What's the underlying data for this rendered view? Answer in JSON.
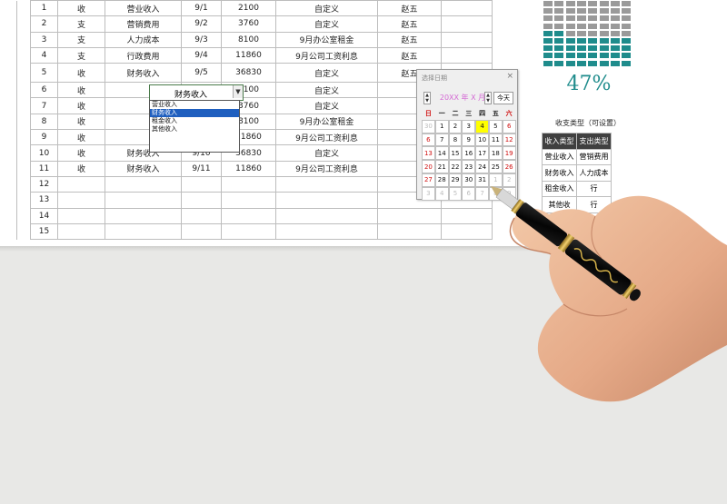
{
  "ledger": {
    "rows": [
      {
        "no": "1",
        "type": "收",
        "category": "营业收入",
        "date": "9/1",
        "amount": "2100",
        "note": "自定义",
        "person": "赵五"
      },
      {
        "no": "2",
        "type": "支",
        "category": "营销费用",
        "date": "9/2",
        "amount": "3760",
        "note": "自定义",
        "person": "赵五"
      },
      {
        "no": "3",
        "type": "支",
        "category": "人力成本",
        "date": "9/3",
        "amount": "8100",
        "note": "9月办公室租金",
        "person": "赵五"
      },
      {
        "no": "4",
        "type": "支",
        "category": "行政费用",
        "date": "9/4",
        "amount": "11860",
        "note": "9月公司工资利息",
        "person": "赵五"
      },
      {
        "no": "5",
        "type": "收",
        "category": "财务收入",
        "date": "9/5",
        "amount": "36830",
        "note": "自定义",
        "person": "赵五"
      },
      {
        "no": "6",
        "type": "收",
        "category": "",
        "date": "9/6",
        "amount": "2100",
        "note": "自定义",
        "person": ""
      },
      {
        "no": "7",
        "type": "收",
        "category": "",
        "date": "9/7",
        "amount": "3760",
        "note": "自定义",
        "person": ""
      },
      {
        "no": "8",
        "type": "收",
        "category": "",
        "date": "9/8",
        "amount": "8100",
        "note": "9月办公室租金",
        "person": ""
      },
      {
        "no": "9",
        "type": "收",
        "category": "",
        "date": "9/9",
        "amount": "11860",
        "note": "9月公司工资利息",
        "person": ""
      },
      {
        "no": "10",
        "type": "收",
        "category": "财务收入",
        "date": "9/10",
        "amount": "36830",
        "note": "自定义",
        "person": ""
      },
      {
        "no": "11",
        "type": "收",
        "category": "财务收入",
        "date": "9/11",
        "amount": "11860",
        "note": "9月公司工资利息",
        "person": ""
      },
      {
        "no": "12",
        "type": "",
        "category": "",
        "date": "",
        "amount": "",
        "note": "",
        "person": ""
      },
      {
        "no": "13",
        "type": "",
        "category": "",
        "date": "",
        "amount": "",
        "note": "",
        "person": ""
      },
      {
        "no": "14",
        "type": "",
        "category": "",
        "date": "",
        "amount": "",
        "note": "",
        "person": ""
      },
      {
        "no": "15",
        "type": "",
        "category": "",
        "date": "",
        "amount": "",
        "note": "",
        "person": ""
      }
    ]
  },
  "dropdown": {
    "current": "财务收入",
    "options": [
      "营业收入",
      "财务收入",
      "租金收入",
      "其他收入"
    ],
    "selected_index": 1
  },
  "progress": {
    "percent_label": "47%",
    "fraction": 0.47,
    "filled_color": "#1f8c8c",
    "empty_color": "#9a9a9a"
  },
  "types_panel": {
    "title": "收支类型（可设置）",
    "headers": [
      "收入类型",
      "支出类型"
    ],
    "rows": [
      [
        "营业收入",
        "营销费用"
      ],
      [
        "财务收入",
        "人力成本"
      ],
      [
        "租金收入",
        "行"
      ],
      [
        "其他收",
        "行"
      ]
    ]
  },
  "datepicker": {
    "title": "选择日期",
    "close": "×",
    "year_month": "20XX 年 X 月",
    "today_label": "今天",
    "weekdays": [
      "日",
      "一",
      "二",
      "三",
      "四",
      "五",
      "六"
    ],
    "weeks": [
      [
        "30",
        "1",
        "2",
        "3",
        "4",
        "5",
        "6"
      ],
      [
        "6",
        "7",
        "8",
        "9",
        "10",
        "11",
        "12"
      ],
      [
        "13",
        "14",
        "15",
        "16",
        "17",
        "18",
        "19"
      ],
      [
        "20",
        "21",
        "22",
        "23",
        "24",
        "25",
        "26"
      ],
      [
        "27",
        "28",
        "29",
        "30",
        "31",
        "1",
        "2"
      ],
      [
        "3",
        "4",
        "5",
        "6",
        "7",
        "8",
        "9"
      ]
    ],
    "highlight": "4"
  }
}
